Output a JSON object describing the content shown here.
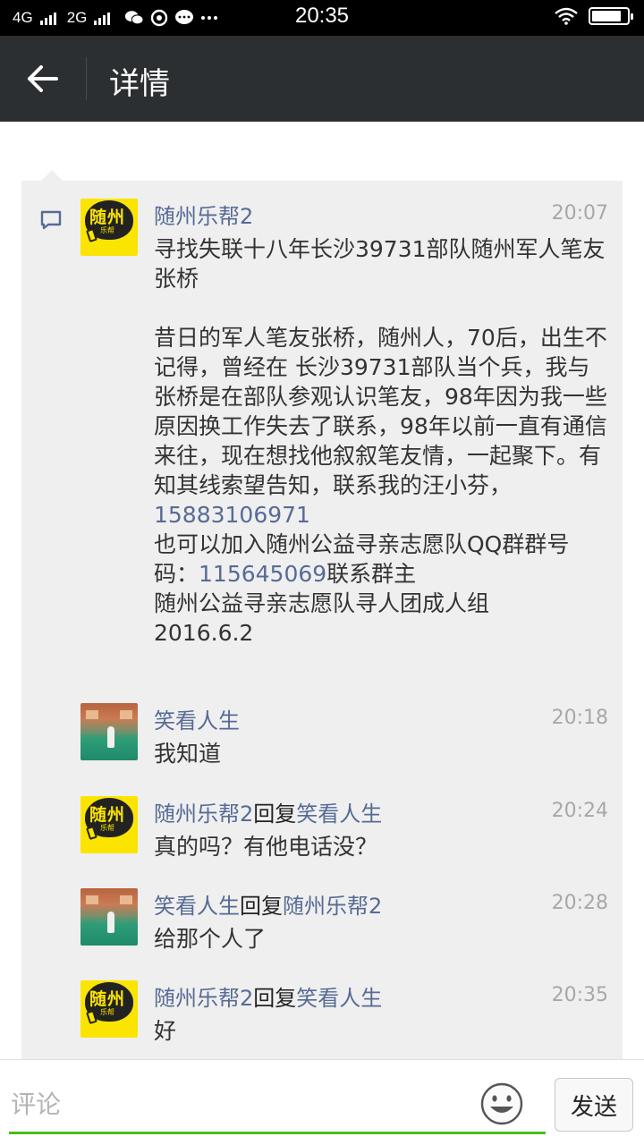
{
  "status_bar": {
    "network1": "4G",
    "network2": "2G",
    "time": "20:35",
    "icons": [
      "signal-icon",
      "wechat-icon",
      "qq-icon",
      "message-icon",
      "more-icon",
      "wifi-icon",
      "battery-icon"
    ],
    "battery_level": 0.85
  },
  "header": {
    "back_icon": "arrow-left-icon",
    "title": "详情"
  },
  "comments": [
    {
      "avatar": "suizhou-lebang-avatar",
      "avatar_text": "随州",
      "avatar_sub": "乐帮",
      "name": "随州乐帮2",
      "time": "20:07",
      "text_pre": "寻找失联十八年长沙39731部队随州军人笔友张桥\n\n昔日的军人笔友张桥，随州人，70后，出生不记得，曾经在 长沙39731部队当个兵，我与张桥是在部队参观认识笔友，98年因为我一些原因换工作失去了联系，98年以前一直有通信来往，现在想找他叙叙笔友情，一起聚下。有知其线索望告知，联系我的汪小芬，",
      "phone": "15883106971",
      "text_mid": "也可以加入随州公益寻亲志愿队QQ群群号码：",
      "qq": "115645069",
      "text_post": "联系群主\n随州公益寻亲志愿队寻人团成人组\n2016.6.2"
    },
    {
      "avatar": "xiaokan-rensheng-avatar",
      "name": "笑看人生",
      "time": "20:18",
      "text": "我知道"
    },
    {
      "avatar": "suizhou-lebang-avatar",
      "name": "随州乐帮2",
      "reply_word": "回复",
      "reply_to": "笑看人生",
      "time": "20:24",
      "text": "真的吗？有他电话没？"
    },
    {
      "avatar": "xiaokan-rensheng-avatar",
      "name": "笑看人生",
      "reply_word": "回复",
      "reply_to": "随州乐帮2",
      "time": "20:28",
      "text": "给那个人了"
    },
    {
      "avatar": "suizhou-lebang-avatar",
      "name": "随州乐帮2",
      "reply_word": "回复",
      "reply_to": "笑看人生",
      "time": "20:35",
      "text": "好"
    }
  ],
  "input_bar": {
    "placeholder": "评论",
    "emoji_icon": "smiley-icon",
    "send_label": "发送",
    "accent": "#45c01a"
  },
  "colors": {
    "title_bar": "#2b2f31",
    "name_link": "#576b95",
    "card_bg": "#efefef"
  }
}
